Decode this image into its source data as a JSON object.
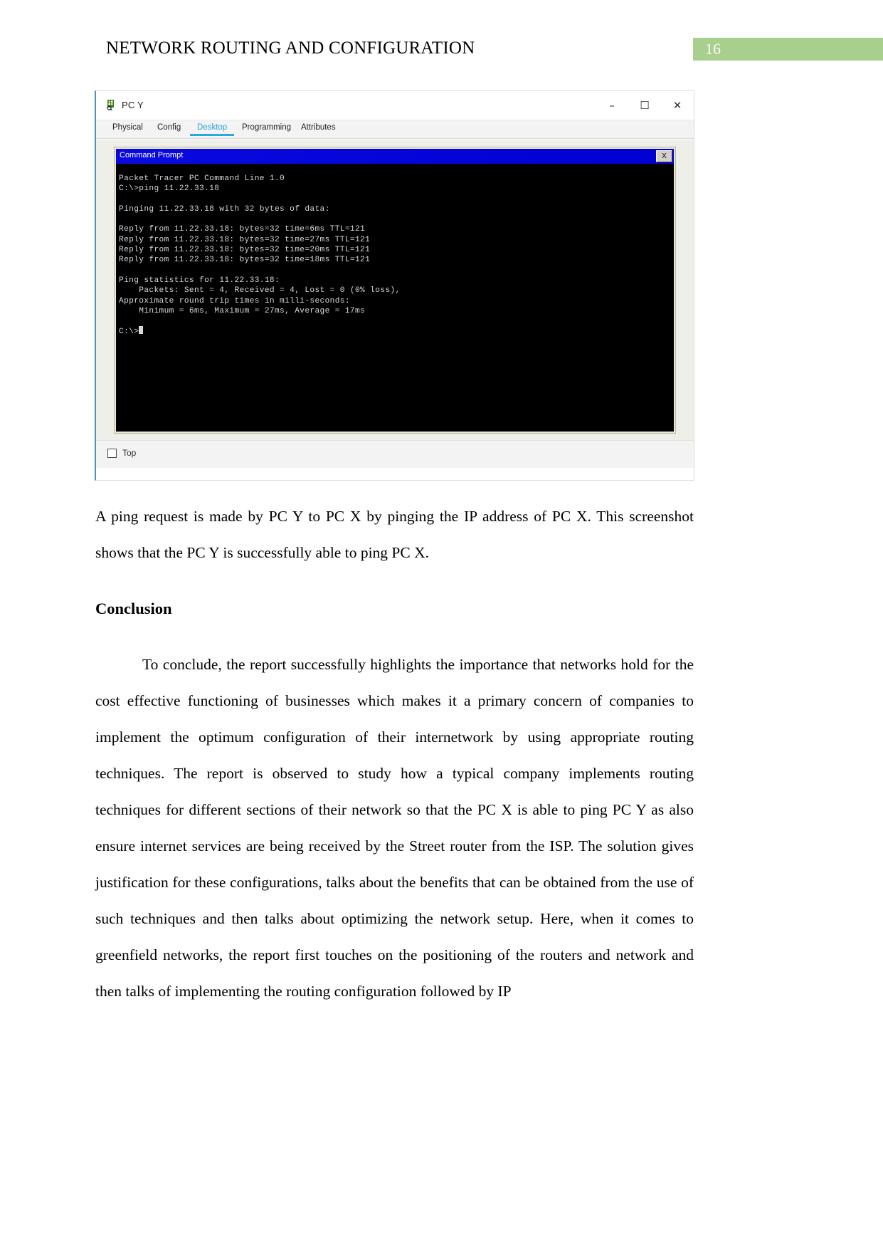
{
  "header": {
    "title": "NETWORK ROUTING AND CONFIGURATION",
    "page_number": "16",
    "badge_color": "#a9cf8f"
  },
  "figure": {
    "window": {
      "title": "PC Y",
      "icon": "packet-tracer-pc-icon",
      "minimize_glyph": "–",
      "maximize_glyph": "☐",
      "close_glyph": "✕"
    },
    "tabs": [
      {
        "label": "Physical",
        "active": false
      },
      {
        "label": "Config",
        "active": false
      },
      {
        "label": "Desktop",
        "active": true
      },
      {
        "label": "Programming",
        "active": false
      },
      {
        "label": "Attributes",
        "active": false
      }
    ],
    "active_tab_color": "#29a9e0",
    "command_prompt": {
      "title": "Command Prompt",
      "titlebar_color": "#0000dd",
      "close_label": "X",
      "lines": [
        "Packet Tracer PC Command Line 1.0",
        "C:\\>ping 11.22.33.18",
        "",
        "Pinging 11.22.33.18 with 32 bytes of data:",
        "",
        "Reply from 11.22.33.18: bytes=32 time=6ms TTL=121",
        "Reply from 11.22.33.18: bytes=32 time=27ms TTL=121",
        "Reply from 11.22.33.18: bytes=32 time=20ms TTL=121",
        "Reply from 11.22.33.18: bytes=32 time=18ms TTL=121",
        "",
        "Ping statistics for 11.22.33.18:",
        "    Packets: Sent = 4, Received = 4, Lost = 0 (0% loss),",
        "Approximate round trip times in milli-seconds:",
        "    Minimum = 6ms, Maximum = 27ms, Average = 17ms",
        "",
        "C:\\>"
      ]
    },
    "statusbar": {
      "top_checkbox_label": "Top",
      "top_checkbox_checked": false
    }
  },
  "body": {
    "caption_paragraph": "A ping request is made by PC Y to PC X by pinging the IP address of PC X. This screenshot shows that the PC Y is successfully able to ping PC X.",
    "conclusion_heading": "Conclusion",
    "conclusion_paragraph": "To conclude, the report successfully highlights the importance that networks hold for the cost effective functioning of businesses which makes it a primary concern of companies to implement the optimum configuration of their internetwork by using appropriate routing techniques. The report is observed to study how a typical company implements routing techniques for different sections of their network so that the PC X is able to ping PC Y as also ensure internet services are being received by the Street router from the ISP. The solution gives justification for these configurations, talks about the benefits that can be obtained from the use of such techniques and then talks about optimizing the network setup. Here, when it comes to greenfield networks, the report first touches on the positioning of the routers and network and then talks of implementing the routing configuration followed by IP"
  }
}
